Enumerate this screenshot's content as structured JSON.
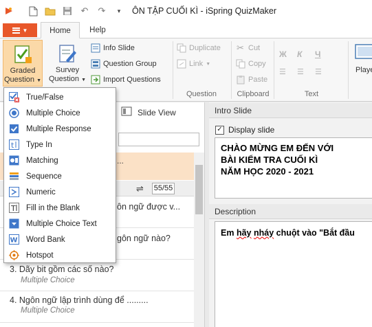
{
  "window": {
    "title": "ÔN TẬP CUỐI KÌ - iSpring QuizMaker"
  },
  "tabs": {
    "file": "",
    "home": "Home",
    "help": "Help"
  },
  "ribbon": {
    "graded_line1": "Graded",
    "graded_line2": "Question",
    "survey_line1": "Survey",
    "survey_line2": "Question",
    "info_slide": "Info Slide",
    "question_group": "Question Group",
    "import_questions": "Import Questions",
    "duplicate": "Duplicate",
    "link": "Link",
    "cut": "Cut",
    "copy": "Copy",
    "paste": "Paste",
    "player": "Playe",
    "group_question": "Question",
    "group_clipboard": "Clipboard",
    "group_text": "Text"
  },
  "menu": [
    {
      "label": "True/False",
      "icon": "true-false-icon"
    },
    {
      "label": "Multiple Choice",
      "icon": "radio-icon"
    },
    {
      "label": "Multiple Response",
      "icon": "checkbox-icon"
    },
    {
      "label": "Type In",
      "icon": "type-in-icon"
    },
    {
      "label": "Matching",
      "icon": "matching-icon"
    },
    {
      "label": "Sequence",
      "icon": "sequence-icon"
    },
    {
      "label": "Numeric",
      "icon": "numeric-icon"
    },
    {
      "label": "Fill in the Blank",
      "icon": "fill-blank-icon"
    },
    {
      "label": "Multiple Choice Text",
      "icon": "dropdown-icon"
    },
    {
      "label": "Word Bank",
      "icon": "word-bank-icon"
    },
    {
      "label": "Hotspot",
      "icon": "hotspot-icon"
    }
  ],
  "left_panel": {
    "slide_view": "Slide View",
    "intro_ellipsis": "...",
    "count": "55/55",
    "q1_trail": "ôn ngữ được v...",
    "q2_trail": "gôn ngữ nào?",
    "questions": [
      {
        "title": "3. Dãy bit gồm các số nào?",
        "type": "Multiple Choice"
      },
      {
        "title": "4. Ngôn ngữ lập trình dùng để .........",
        "type": "Multiple Choice"
      }
    ]
  },
  "right_panel": {
    "intro_header": "Intro Slide",
    "display_slide": "Display slide",
    "display_checked": true,
    "intro_lines": [
      "CHÀO MỪNG EM ĐẾN VỚI",
      "BÀI KIỂM TRA CUỐI KÌ",
      "NĂM HỌC 2020 - 2021"
    ],
    "description_header": "Description",
    "description_pre": "Em ",
    "description_hay": "hãy",
    "description_mid": " ",
    "description_nhay": "nháy",
    "description_post": " chuột vào \"Bắt đầu"
  },
  "colors": {
    "accent": "#e8572a",
    "selected": "#fbd9a8",
    "intro_row": "#fbe1c6"
  }
}
